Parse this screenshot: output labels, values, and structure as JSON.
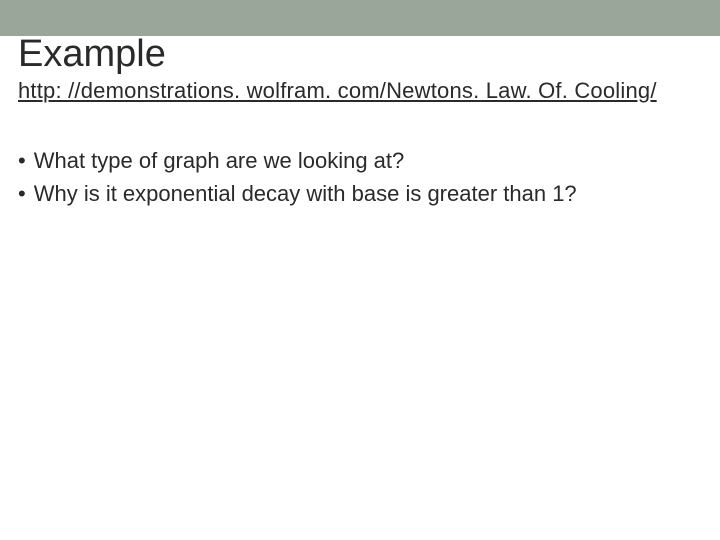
{
  "slide": {
    "title": "Example",
    "link": "http: //demonstrations. wolfram. com/Newtons. Law. Of. Cooling/",
    "bullets": [
      "What type of graph are we looking at?",
      "Why is it exponential decay with base is greater than 1?"
    ]
  }
}
